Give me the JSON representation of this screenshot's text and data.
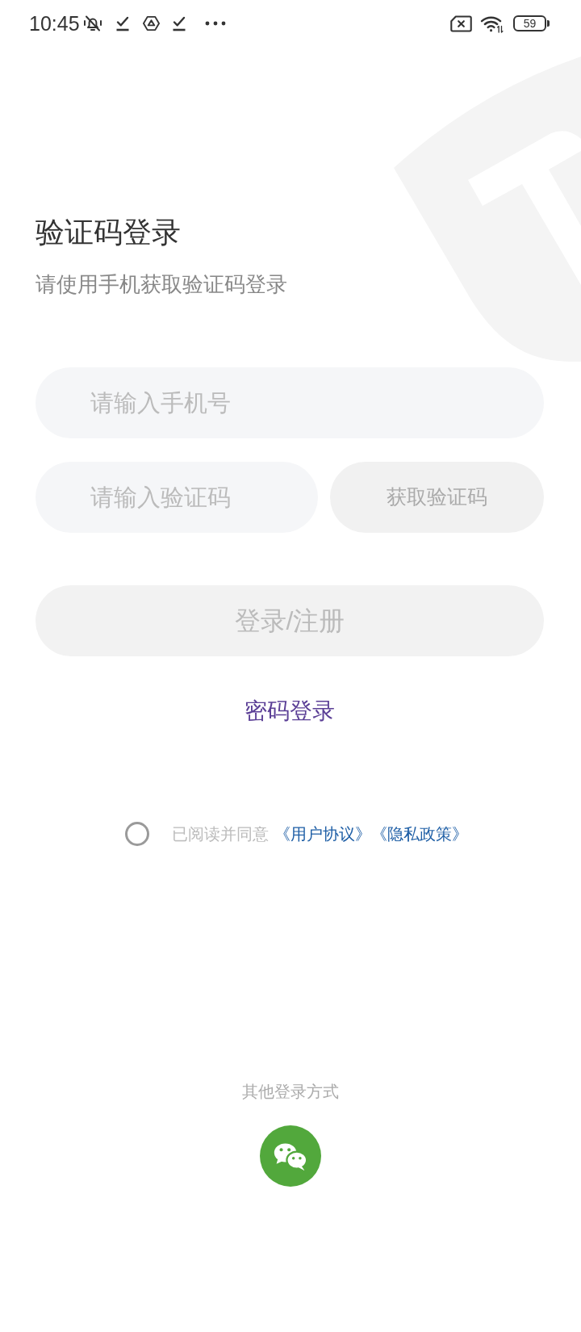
{
  "status_bar": {
    "time": "10:45",
    "battery": "59"
  },
  "header": {
    "title": "验证码登录",
    "subtitle": "请使用手机获取验证码登录"
  },
  "form": {
    "phone": {
      "placeholder": "请输入手机号"
    },
    "code": {
      "placeholder": "请输入验证码"
    },
    "get_code_button": "获取验证码",
    "submit_button": "登录/注册"
  },
  "password_login_link": "密码登录",
  "agreement": {
    "checked": false,
    "label": "已阅读并同意",
    "links": [
      "《用户协议》",
      "《隐私政策》"
    ]
  },
  "other_login": {
    "label": "其他登录方式"
  }
}
